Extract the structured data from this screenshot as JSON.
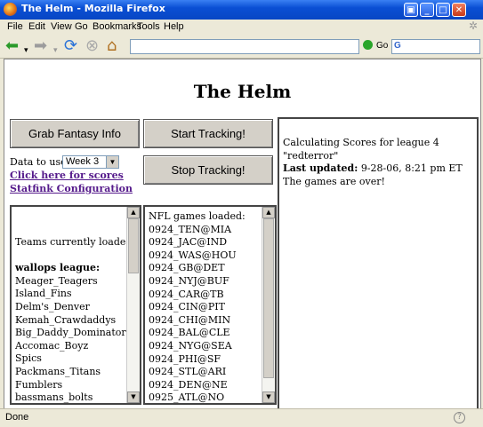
{
  "window": {
    "title": "The Helm - Mozilla Firefox"
  },
  "menu": [
    "File",
    "Edit",
    "View",
    "Go",
    "Bookmarks",
    "Tools",
    "Help"
  ],
  "nav": {
    "url": "",
    "go_label": "Go",
    "search_placeholder": ""
  },
  "page": {
    "heading": "The Helm",
    "buttons": {
      "grab": "Grab Fantasy Info",
      "start": "Start Tracking!",
      "stop": "Stop Tracking!"
    },
    "data_to_use_label": "Data to use:",
    "week_selected": "Week 3",
    "links": {
      "scores": "Click here for scores",
      "statfink": "Statfink Configuration"
    },
    "status": {
      "calculating": "Calculating Scores for league 4 \"redterror\"",
      "last_updated_label": "Last updated:",
      "last_updated_value": "9-28-06, 8:21 pm ET",
      "games_over": "The games are over!"
    },
    "teams": {
      "header": "Teams currently loaded:",
      "league": "wallops league:",
      "items": [
        "Meager_Teagers",
        "Island_Fins",
        "Delm's_Denver",
        "Kemah_Crawdaddys",
        "Big_Daddy_Dominators",
        "Accomac_Boyz",
        "Spics",
        "Packmans_Titans",
        "Fumblers",
        "bassmans_bolts"
      ]
    },
    "games": {
      "header": "NFL games loaded:",
      "items": [
        "0924_TEN@MIA",
        "0924_JAC@IND",
        "0924_WAS@HOU",
        "0924_GB@DET",
        "0924_NYJ@BUF",
        "0924_CAR@TB",
        "0924_CIN@PIT",
        "0924_CHI@MIN",
        "0924_BAL@CLE",
        "0924_NYG@SEA",
        "0924_PHI@SF",
        "0924_STL@ARI",
        "0924_DEN@NE",
        "0925_ATL@NO"
      ]
    }
  },
  "statusbar": {
    "text": "Done"
  }
}
